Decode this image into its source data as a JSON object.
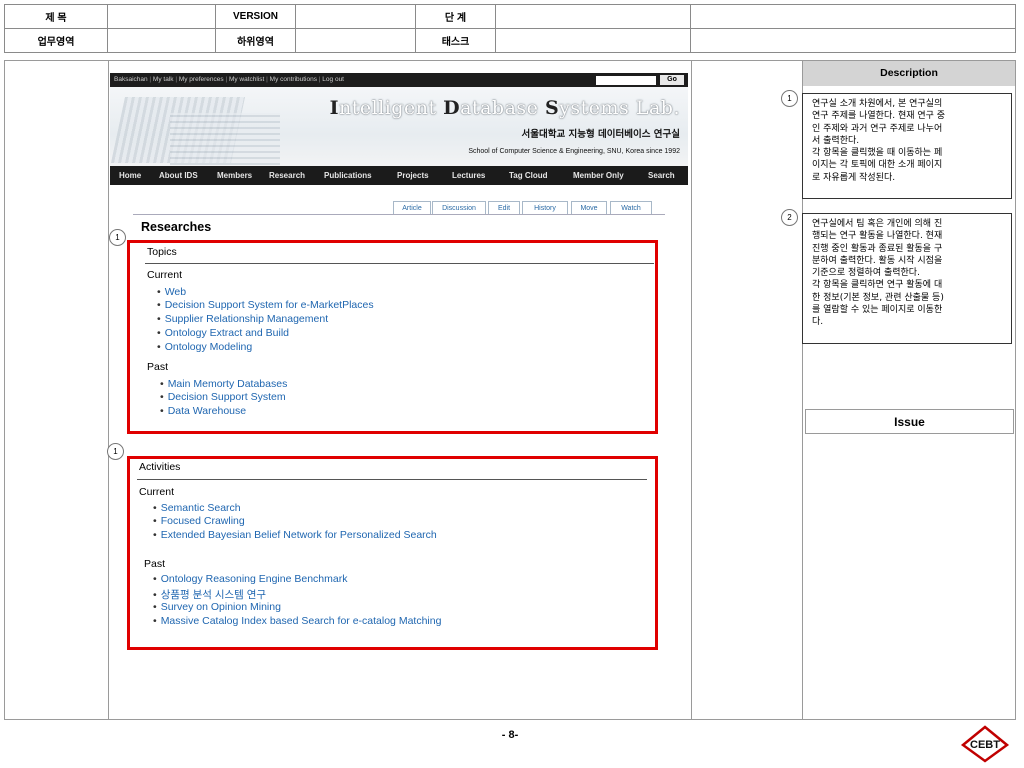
{
  "header": {
    "title_label": "제 목",
    "version_label": "VERSION",
    "stage_label": "단 계",
    "business_area_label": "업무영역",
    "sub_area_label": "하위영역",
    "task_label": "태스크"
  },
  "wiki": {
    "topbar": {
      "links": [
        "Baksaichan",
        "My talk",
        "My preferences",
        "My watchlist",
        "My contributions",
        "Log out"
      ],
      "go_label": "Go"
    },
    "banner": {
      "lab_title_parts": [
        "I",
        "ntelligent ",
        "D",
        "atabase ",
        "S",
        "ystems Lab."
      ],
      "korean_name": "서울대학교 지능형 데이터베이스 연구실",
      "school_line": "School of Computer Science & Engineering, SNU, Korea since 1992"
    },
    "nav": [
      "Home",
      "About IDS",
      "Members",
      "Research",
      "Publications",
      "Projects",
      "Lectures",
      "Tag Cloud",
      "Member Only",
      "Search"
    ],
    "tabs": [
      "Article",
      "Discussion",
      "Edit",
      "History",
      "Move",
      "Watch"
    ],
    "page_title": "Researches",
    "topics": {
      "heading": "Topics",
      "current_label": "Current",
      "current": [
        "Web",
        "Decision Support System for e-MarketPlaces",
        "Supplier Relationship Management",
        "Ontology Extract and Build",
        "Ontology Modeling"
      ],
      "past_label": "Past",
      "past": [
        "Main Memorty Databases",
        "Decision Support System",
        "Data Warehouse"
      ]
    },
    "activities": {
      "heading": "Activities",
      "current_label": "Current",
      "current": [
        "Semantic Search",
        "Focused Crawling",
        "Extended Bayesian Belief Network for Personalized Search"
      ],
      "past_label": "Past",
      "past": [
        "Ontology Reasoning Engine Benchmark",
        "상품평 분석 시스템 연구",
        "Survey on Opinion Mining",
        "Massive Catalog Index based Search for e-catalog Matching"
      ]
    },
    "markers": [
      "1",
      "1",
      "1"
    ]
  },
  "description": {
    "title": "Description",
    "items": [
      {
        "num": "1",
        "lines": [
          "연구실 소개 차원에서, 본 연구실의",
          "연구 주제를 나열한다. 현재 연구 중",
          "인 주제와 과거 연구 주제로 나누어",
          "서 출력한다.",
          "각 항목을 클릭했을 때 이동하는 페",
          "이지는 각 토픽에 대한 소개 페이지",
          "로 자유롭게 작성된다."
        ]
      },
      {
        "num": "2",
        "lines": [
          "연구실에서 팀 혹은 개인에 의해 진",
          "행되는 연구 활동을 나열한다. 현재",
          "진행 중인 활동과 종료된 활동을 구",
          "분하여 출력한다. 활동 시작 시점을",
          "기준으로 정렬하여 출력한다.",
          "각 항목을 클릭하면 연구 활동에 대",
          "한 정보(기본 정보, 관련 산출물 등)",
          "를 열람할 수 있는 페이지로 이동한",
          "다."
        ]
      }
    ],
    "issue_label": "Issue"
  },
  "footer": {
    "page_number": "- 8-",
    "logo_text": "CEBT"
  },
  "colors": {
    "highlight_box": "#e00000",
    "link": "#1f66b0",
    "nav_bg": "#1b1b1b"
  }
}
